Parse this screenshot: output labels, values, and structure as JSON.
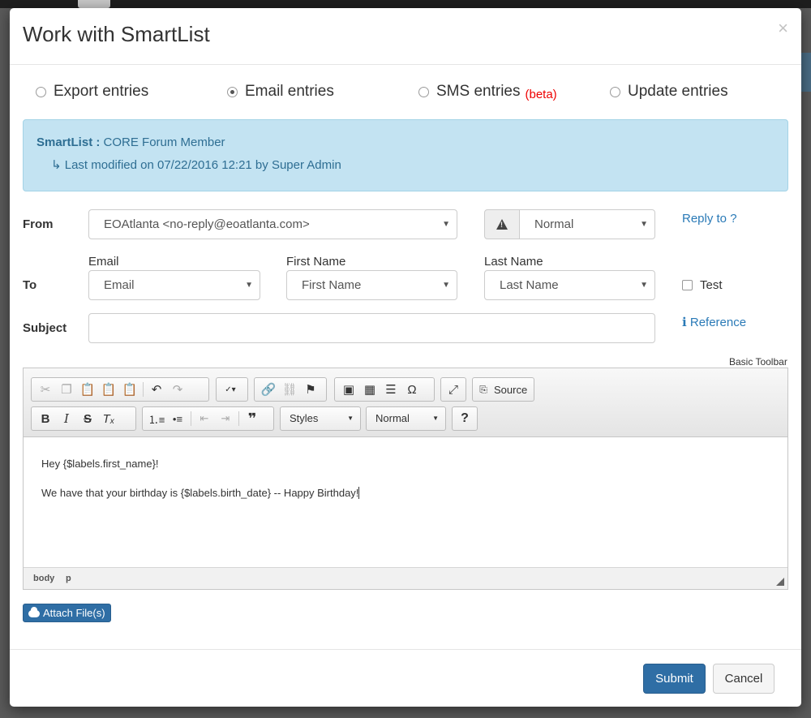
{
  "modal": {
    "title": "Work with SmartList",
    "close_glyph": "×"
  },
  "actions": [
    {
      "label": "Export entries",
      "checked": false
    },
    {
      "label": "Email entries",
      "checked": true
    },
    {
      "label": "SMS entries",
      "badge": "(beta)",
      "checked": false
    },
    {
      "label": "Update entries",
      "checked": false
    }
  ],
  "smartlist": {
    "label": "SmartList :",
    "name": "CORE Forum Member",
    "modified_arrow": "↳",
    "modified": "Last modified on 07/22/2016 12:21 by Super Admin"
  },
  "form": {
    "from_label": "From",
    "from_value": "EOAtlanta <no-reply@eoatlanta.com>",
    "priority_icon": "warning-icon",
    "priority_value": "Normal",
    "reply_to": "Reply to ?",
    "to_label": "To",
    "col_email": "Email",
    "col_first": "First Name",
    "col_last": "Last Name",
    "email_value": "Email",
    "first_value": "First Name",
    "last_value": "Last Name",
    "test_label": "Test",
    "subject_label": "Subject",
    "subject_value": "",
    "reference_icon": "ℹ",
    "reference_label": "Reference",
    "toolbar_mode": "Basic Toolbar"
  },
  "editor": {
    "source_label": "Source",
    "styles_label": "Styles",
    "format_label": "Normal",
    "help_glyph": "?",
    "content": [
      "Hey {$labels.first_name}!",
      "We have that your birthday is {$labels.birth_date} -- Happy Birthday!"
    ],
    "path": [
      "body",
      "p"
    ]
  },
  "attach_label": "Attach File(s)",
  "footer": {
    "submit": "Submit",
    "cancel": "Cancel"
  },
  "colors": {
    "primary": "#2f6ea5",
    "info_bg": "#c3e3f2",
    "link": "#2a7ab7",
    "beta": "#ee0000"
  }
}
